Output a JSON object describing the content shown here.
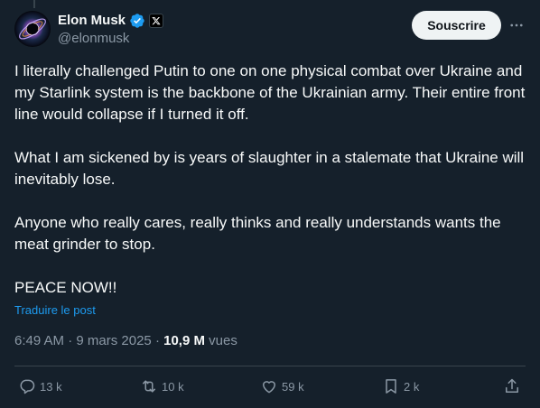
{
  "author": {
    "display_name": "Elon Musk",
    "handle": "@elonmusk",
    "verified_icon": "verified-badge-icon",
    "affiliation_icon": "x-logo-icon"
  },
  "header": {
    "subscribe_label": "Souscrire",
    "more_icon": "more-horizontal-icon"
  },
  "tweet": {
    "paragraphs": [
      "I literally challenged Putin to one on one physical combat over Ukraine and my Starlink system is the backbone of the Ukrainian army. Their entire front line would collapse if I turned it off.",
      "What I am sickened by is years of slaughter in a stalemate that Ukraine will inevitably lose.",
      "Anyone who really cares, really thinks and really understands wants the meat grinder to stop.",
      "PEACE NOW!!"
    ],
    "translate_label": "Traduire le post",
    "time": "6:49 AM",
    "date": "9 mars 2025",
    "separator": "·",
    "views_count": "10,9 M",
    "views_label": "vues"
  },
  "actions": {
    "reply_count": "13 k",
    "repost_count": "10 k",
    "like_count": "59 k",
    "bookmark_count": "2 k"
  },
  "colors": {
    "background": "#15202b",
    "accent": "#1d9bf0",
    "text": "#f7f9f9",
    "muted": "#8b98a5",
    "border": "#38444d"
  }
}
